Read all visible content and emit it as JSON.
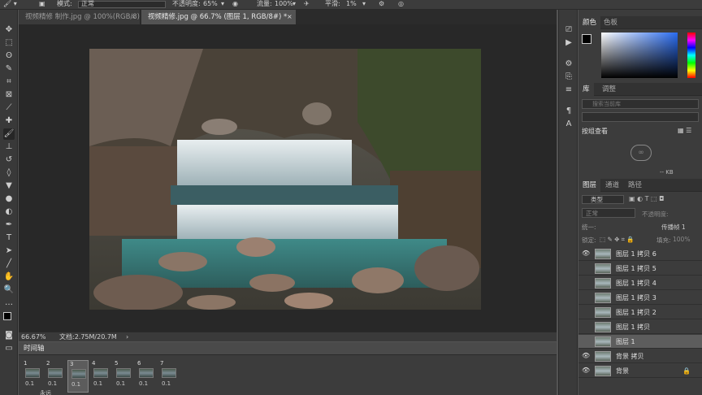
{
  "options_bar": {
    "mode_label": "模式:",
    "mode_value": "正常",
    "opacity_label": "不透明度:",
    "opacity_value": "65%",
    "flow_label": "流量:",
    "flow_value": "100%",
    "smooth_label": "平滑:",
    "smooth_value": "1%"
  },
  "tabs": [
    {
      "label": "视频精修 制作.jpg @ 100%(RGB/8)",
      "active": false
    },
    {
      "label": "视频精修.jpg @ 66.7% (图层 1, RGB/8#) *",
      "active": true
    }
  ],
  "status_bar": {
    "zoom": "66.67%",
    "doc_info": "文档:2.75M/20.7M"
  },
  "timeline": {
    "title": "时间轴",
    "frames": [
      {
        "num": "1",
        "duration": "0.1"
      },
      {
        "num": "2",
        "duration": "0.1"
      },
      {
        "num": "3",
        "duration": "0.1"
      },
      {
        "num": "4",
        "duration": "0.1"
      },
      {
        "num": "5",
        "duration": "0.1"
      },
      {
        "num": "6",
        "duration": "0.1"
      },
      {
        "num": "7",
        "duration": "0.1"
      }
    ],
    "loop_label": "永远"
  },
  "color_panel": {
    "tabs": [
      "颜色",
      "色板"
    ],
    "accent_hue": "#2a6cf0"
  },
  "library_panel": {
    "tabs": [
      "库",
      "调整"
    ],
    "search_placeholder": "搜索当前库",
    "group_label": "按组查看",
    "size_label": "-- KB"
  },
  "layers_panel": {
    "tabs": [
      "图层",
      "通道",
      "路径"
    ],
    "filter_label": "类型",
    "blend_mode": "正常",
    "opacity_label": "不透明度:",
    "unify_label": "统一:",
    "propagate_label": "传播帧 1",
    "lock_label": "锁定:",
    "fill_label": "填充:",
    "fill_value": "100%",
    "layers": [
      {
        "name": "图层 1 拷贝 6",
        "visible": true,
        "selected": false,
        "locked": false
      },
      {
        "name": "图层 1 拷贝 5",
        "visible": false,
        "selected": false,
        "locked": false
      },
      {
        "name": "图层 1 拷贝 4",
        "visible": false,
        "selected": false,
        "locked": false
      },
      {
        "name": "图层 1 拷贝 3",
        "visible": false,
        "selected": false,
        "locked": false
      },
      {
        "name": "图层 1 拷贝 2",
        "visible": false,
        "selected": false,
        "locked": false
      },
      {
        "name": "图层 1 拷贝",
        "visible": false,
        "selected": false,
        "locked": false
      },
      {
        "name": "图层 1",
        "visible": false,
        "selected": true,
        "locked": false
      },
      {
        "name": "背景 拷贝",
        "visible": true,
        "selected": false,
        "locked": false
      },
      {
        "name": "背景",
        "visible": true,
        "selected": false,
        "locked": true
      }
    ]
  }
}
